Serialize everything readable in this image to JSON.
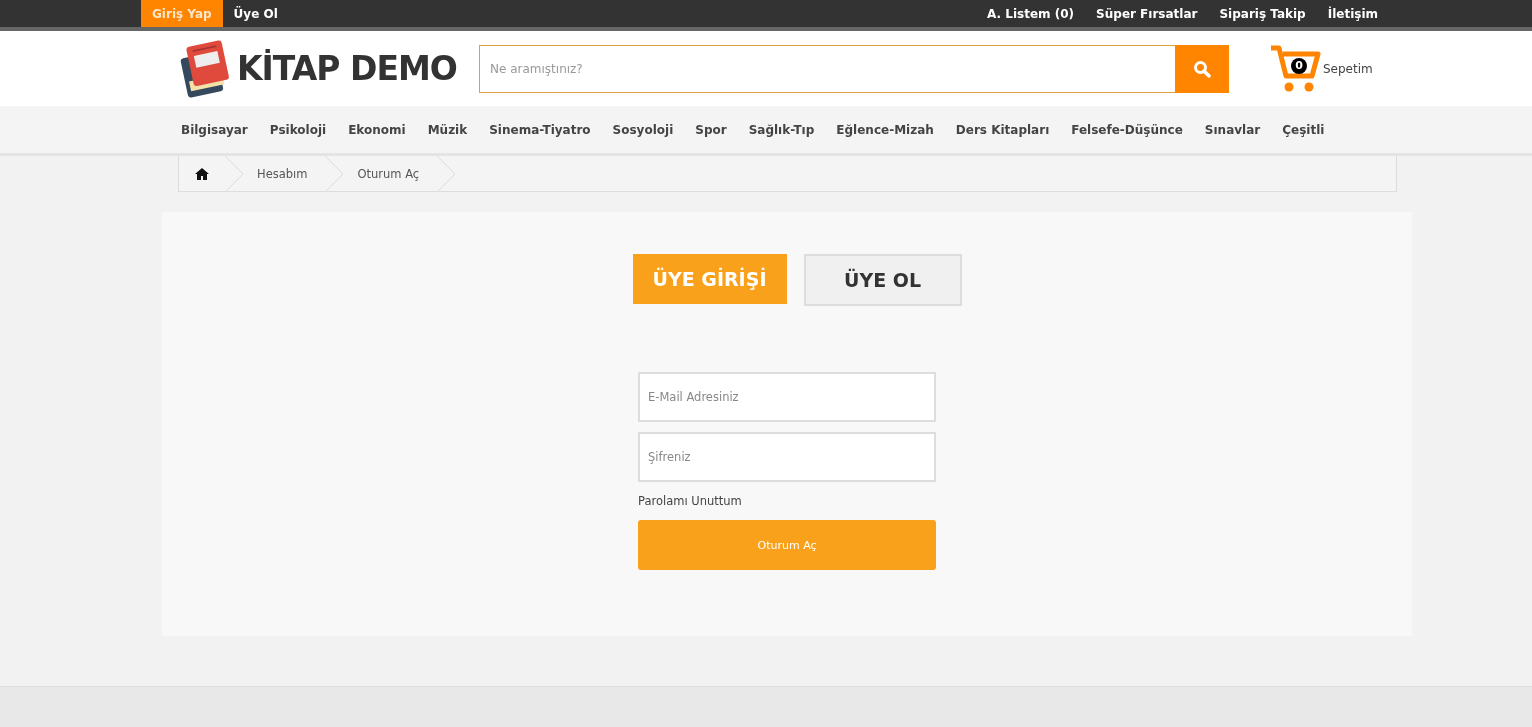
{
  "topbar": {
    "left_links": [
      {
        "label": "Giriş Yap",
        "selected": true
      },
      {
        "label": "Üye Ol",
        "selected": false
      }
    ],
    "right_links": [
      "A. Listem (0)",
      "Süper Fırsatlar",
      "Sipariş Takip",
      "İletişim"
    ]
  },
  "header": {
    "logo": "KİTAP DEMO",
    "search": {
      "placeholder": "Ne aramıştınız?"
    },
    "cart": {
      "count": "0",
      "label": "Sepetim"
    }
  },
  "categories": [
    "Bilgisayar",
    "Psikoloji",
    "Ekonomi",
    "Müzik",
    "Sinema-Tiyatro",
    "Sosyoloji",
    "Spor",
    "Sağlık-Tıp",
    "Eğlence-Mizah",
    "Ders Kitapları",
    "Felsefe-Düşünce",
    "Sınavlar",
    "Çeşitli"
  ],
  "breadcrumb": [
    "Hesabım",
    "Oturum Aç"
  ],
  "tabs": [
    {
      "label": "ÜYE GİRİŞİ",
      "selected": true
    },
    {
      "label": "ÜYE OL",
      "selected": false
    }
  ],
  "form": {
    "email": {
      "placeholder": "E-Mail Adresiniz"
    },
    "password": {
      "placeholder": "Şifreniz"
    },
    "forgot": "Parolamı Unuttum",
    "submit": "Oturum Aç"
  }
}
